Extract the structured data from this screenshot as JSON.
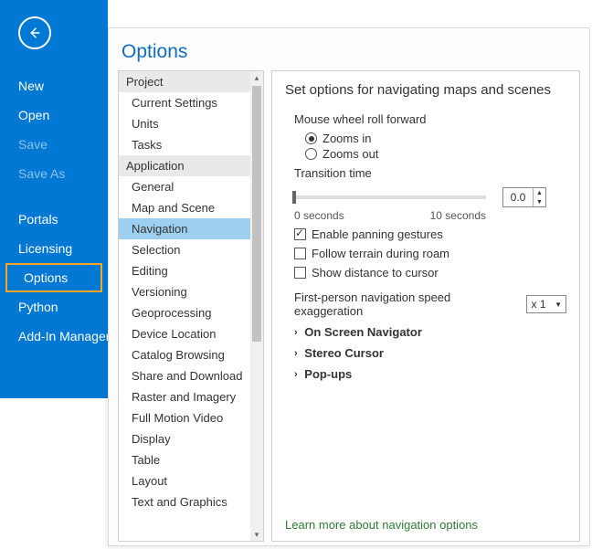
{
  "panel_title": "Options",
  "left_rail": {
    "items": [
      {
        "label": "New",
        "dim": false
      },
      {
        "label": "Open",
        "dim": false
      },
      {
        "label": "Save",
        "dim": true
      },
      {
        "label": "Save As",
        "dim": true
      },
      {
        "label": "Portals",
        "dim": false
      },
      {
        "label": "Licensing",
        "dim": false
      },
      {
        "label": "Options",
        "dim": false,
        "selected": true
      },
      {
        "label": "Python",
        "dim": false
      },
      {
        "label": "Add-In Manager",
        "dim": false
      }
    ]
  },
  "categories": {
    "sections": [
      {
        "header": "Project",
        "items": [
          "Current Settings",
          "Units",
          "Tasks"
        ]
      },
      {
        "header": "Application",
        "items": [
          "General",
          "Map and Scene",
          "Navigation",
          "Selection",
          "Editing",
          "Versioning",
          "Geoprocessing",
          "Device Location",
          "Catalog Browsing",
          "Share and Download",
          "Raster and Imagery",
          "Full Motion Video",
          "Display",
          "Table",
          "Layout",
          "Text and Graphics"
        ]
      }
    ],
    "selected": "Navigation"
  },
  "right": {
    "heading": "Set options for navigating maps and scenes",
    "mouse_label": "Mouse wheel roll forward",
    "radio_in": "Zooms in",
    "radio_out": "Zooms out",
    "radio_checked": "in",
    "transition_label": "Transition time",
    "transition_value": "0.0",
    "slider_left": "0 seconds",
    "slider_right": "10 seconds",
    "check_panning": {
      "label": "Enable panning gestures",
      "checked": true
    },
    "check_terrain": {
      "label": "Follow terrain during roam",
      "checked": false
    },
    "check_distance": {
      "label": "Show distance to cursor",
      "checked": false
    },
    "speed_label": "First-person navigation speed exaggeration",
    "speed_value": "x 1",
    "expanders": [
      "On Screen Navigator",
      "Stereo Cursor",
      "Pop-ups"
    ],
    "learn_more": "Learn more about navigation options"
  }
}
